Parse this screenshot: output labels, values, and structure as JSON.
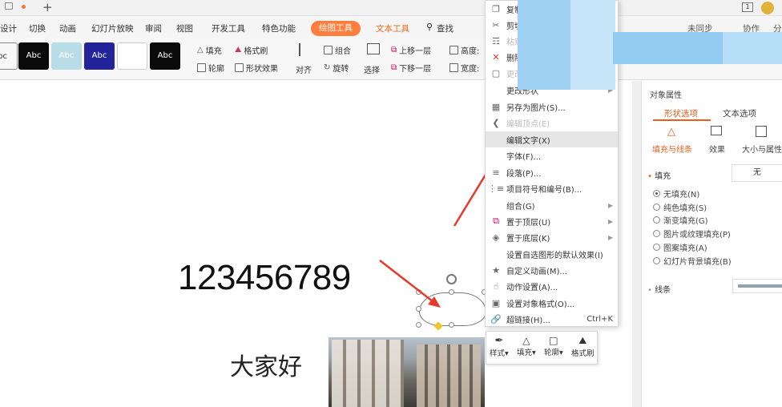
{
  "tabbar": {
    "add_label": "+"
  },
  "ribbon_tabs": [
    {
      "label": "设计"
    },
    {
      "label": "切换"
    },
    {
      "label": "动画"
    },
    {
      "label": "幻灯片放映"
    },
    {
      "label": "审阅"
    },
    {
      "label": "视图"
    },
    {
      "label": "开发工具"
    },
    {
      "label": "特色功能"
    },
    {
      "label": "绘图工具"
    },
    {
      "label": "文本工具"
    },
    {
      "label": "查找"
    }
  ],
  "sync": {
    "unsynced": "未同步",
    "collab": "协作",
    "share": "分"
  },
  "styles": [
    {
      "label": "bc",
      "bg": "#ffffff",
      "fg": "#222"
    },
    {
      "label": "Abc",
      "bg": "#0b0b0b",
      "fg": "#fff"
    },
    {
      "label": "Abc",
      "bg": "#b9dde6",
      "fg": "#fff"
    },
    {
      "label": "Abc",
      "bg": "#23239a",
      "fg": "#fff"
    },
    {
      "label": "",
      "bg": "#ffffff",
      "fg": "#222"
    },
    {
      "label": "Abc",
      "bg": "#0b0b0b",
      "fg": "#fff"
    }
  ],
  "ribbon": {
    "fill": "填充",
    "format_brush": "格式刷",
    "outline": "轮廓",
    "shape_effect": "形状效果",
    "align": "对齐",
    "group": "组合",
    "rotate": "旋转",
    "select": "选择",
    "bring_forward": "上移一层",
    "send_backward": "下移一层",
    "height": "高度:",
    "width": "宽度:"
  },
  "slide": {
    "numbers": "123456789",
    "greeting": "大家好"
  },
  "context_menu": {
    "items": [
      {
        "label": "复制",
        "icon": "copy-icon",
        "disabled": false
      },
      {
        "label": "剪切",
        "icon": "cut-icon",
        "disabled": false
      },
      {
        "label": "粘贴",
        "icon": "paste-icon",
        "disabled": true
      },
      {
        "label": "删除",
        "icon": "delete-icon",
        "disabled": false
      },
      {
        "label": "更改",
        "icon": "change-icon",
        "disabled": true
      },
      {
        "label": "更改形状",
        "icon": "",
        "disabled": false,
        "submenu": true
      },
      {
        "label": "另存为图片(S)...",
        "icon": "image-icon",
        "disabled": false
      },
      {
        "label": "编辑顶点(E)",
        "icon": "vertex-icon",
        "disabled": true
      },
      {
        "label": "编辑文字(X)",
        "icon": "edit-text-icon",
        "disabled": false,
        "highlight": true
      },
      {
        "label": "字体(F)...",
        "icon": "font-icon",
        "disabled": false
      },
      {
        "label": "段落(P)...",
        "icon": "paragraph-icon",
        "disabled": false
      },
      {
        "label": "项目符号和编号(B)...",
        "icon": "bullets-icon",
        "disabled": false
      },
      {
        "label": "组合(G)",
        "icon": "",
        "disabled": false,
        "submenu": true
      },
      {
        "label": "置于顶层(U)",
        "icon": "bring-front-icon",
        "disabled": false,
        "submenu": true
      },
      {
        "label": "置于底层(K)",
        "icon": "send-back-icon",
        "disabled": false,
        "submenu": true
      },
      {
        "label": "设置自选图形的默认效果(I)",
        "icon": "",
        "disabled": false
      },
      {
        "label": "自定义动画(M)...",
        "icon": "animation-icon",
        "disabled": false
      },
      {
        "label": "动作设置(A)...",
        "icon": "action-icon",
        "disabled": false
      },
      {
        "label": "设置对象格式(O)...",
        "icon": "format-icon",
        "disabled": false
      },
      {
        "label": "超链接(H)...",
        "icon": "link-icon",
        "disabled": false,
        "shortcut": "Ctrl+K"
      }
    ]
  },
  "mini_toolbar": [
    {
      "label": "样式"
    },
    {
      "label": "填充"
    },
    {
      "label": "轮廓"
    },
    {
      "label": "格式刷"
    }
  ],
  "pane": {
    "title": "对象属性",
    "tab_shape": "形状选项",
    "tab_text": "文本选项",
    "sub_fill_line": "填充与线条",
    "sub_effect": "效果",
    "sub_size": "大小与属性",
    "fill_label": "填充",
    "fill_value": "无",
    "fill_options": [
      {
        "label": "无填充(N)",
        "checked": true
      },
      {
        "label": "纯色填充(S)",
        "checked": false
      },
      {
        "label": "渐变填充(G)",
        "checked": false
      },
      {
        "label": "图片或纹理填充(P)",
        "checked": false
      },
      {
        "label": "图案填充(A)",
        "checked": false
      },
      {
        "label": "幻灯片背景填充(B)",
        "checked": false
      }
    ],
    "line_label": "线条"
  },
  "colors": {
    "accent": "#ff7e3d",
    "text_tool": "#f06a1b",
    "arrow": "#e8392d"
  }
}
